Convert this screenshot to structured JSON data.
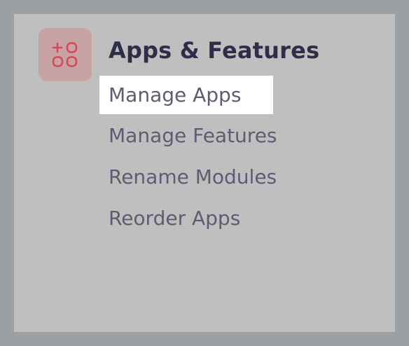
{
  "menu": {
    "title": "Apps & Features",
    "icon": "apps-features-icon",
    "accent_color": "#d9485a",
    "items": [
      {
        "label": "Manage Apps",
        "highlighted": true
      },
      {
        "label": "Manage Features",
        "highlighted": false
      },
      {
        "label": "Rename Modules",
        "highlighted": false
      },
      {
        "label": "Reorder Apps",
        "highlighted": false
      }
    ]
  }
}
